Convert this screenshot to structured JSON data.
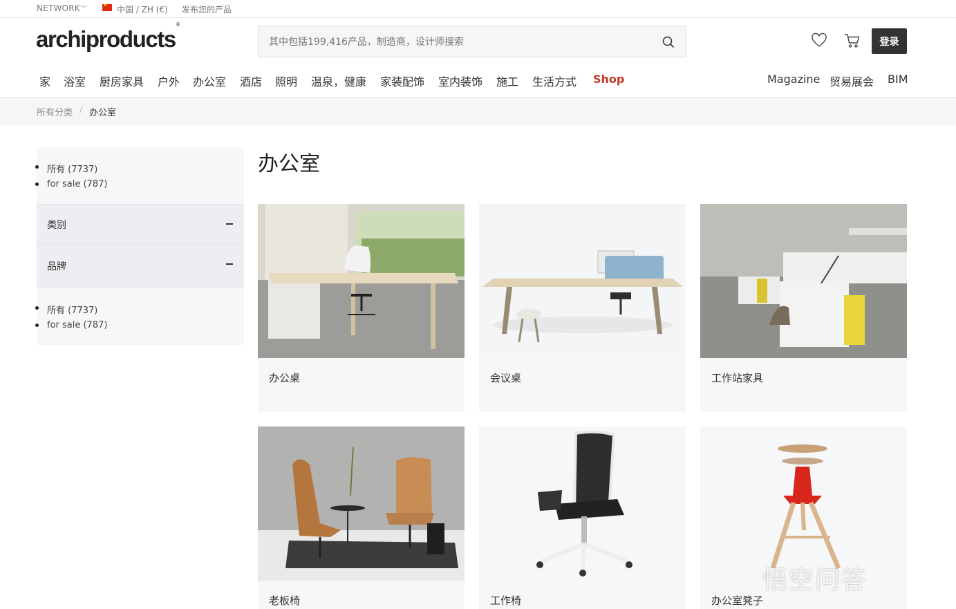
{
  "topbar": {
    "network": "NETWORK",
    "country": "中国 / ZH (€)",
    "publish": "发布您的产品"
  },
  "header": {
    "logo": "archiproducts",
    "logo_mark": "®",
    "search_placeholder": "其中包括199,416产品，制造商，设计师搜索",
    "login_label": "登录",
    "icons": [
      "heart-icon",
      "cart-icon",
      "search-icon"
    ]
  },
  "nav": {
    "items": [
      "家",
      "浴室",
      "厨房家具",
      "户外",
      "办公室",
      "酒店",
      "照明",
      "温泉，健康",
      "家装配饰",
      "室内装饰",
      "施工",
      "生活方式",
      "Shop"
    ],
    "right_items": [
      "Magazine",
      "贸易展会",
      "BIM"
    ],
    "shop_color": "#c0392b"
  },
  "breadcrumb": {
    "all": "所有分类",
    "separator": "/",
    "current": "办公室"
  },
  "sidebar": {
    "top_list": [
      "所有 (7737)",
      "for sale (787)"
    ],
    "sections": [
      "类别",
      "品牌"
    ],
    "bottom_list": [
      "所有 (7737)",
      "for sale (787)"
    ]
  },
  "main": {
    "title": "办公室",
    "cards": [
      "办公桌",
      "会议桌",
      "工作站家具",
      "老板椅",
      "工作椅",
      "办公室凳子"
    ]
  },
  "watermark": "悟空问答"
}
